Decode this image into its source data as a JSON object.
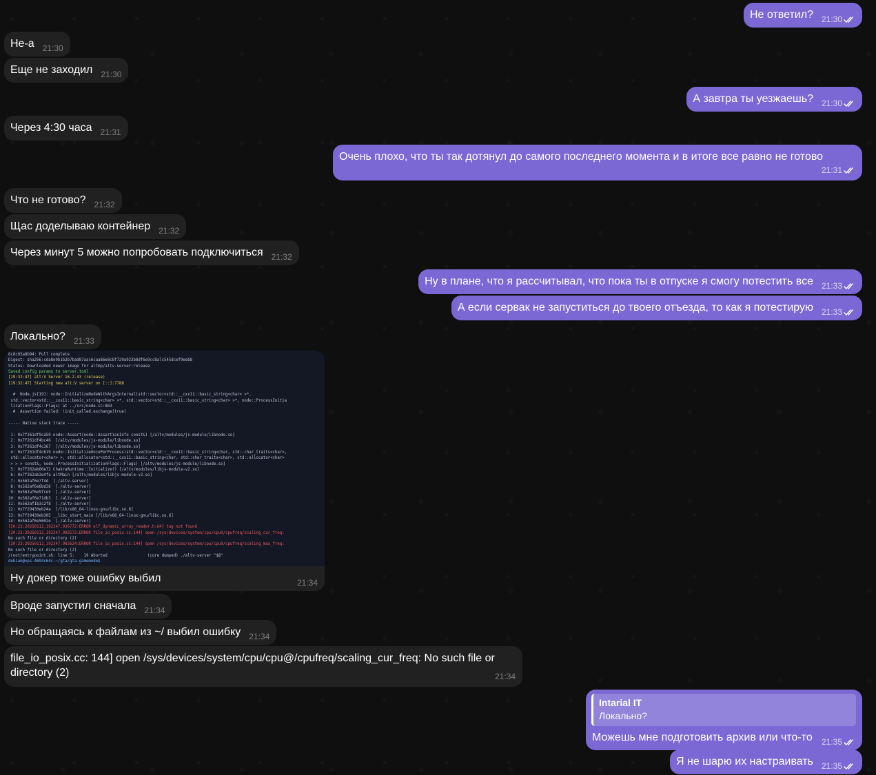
{
  "messages": [
    {
      "dir": "out",
      "text": "Не ответил?",
      "time": "21:30"
    },
    {
      "dir": "in",
      "text": "Не-а",
      "time": "21:30"
    },
    {
      "dir": "in",
      "text": "Еще не заходил",
      "time": "21:30"
    },
    {
      "dir": "out",
      "text": "А завтра ты уезжаешь?",
      "time": "21:30"
    },
    {
      "dir": "in",
      "text": "Через 4:30 часа",
      "time": "21:31"
    },
    {
      "dir": "out",
      "text": "Очень плохо, что ты так дотянул до самого последнего момента и в итоге все равно не готово",
      "time": "21:31"
    },
    {
      "dir": "in",
      "text": "Что не готово?",
      "time": "21:32"
    },
    {
      "dir": "in",
      "text": "Щас доделываю контейнер",
      "time": "21:32"
    },
    {
      "dir": "in",
      "text": "Через минут 5 можно попробовать подключиться",
      "time": "21:32"
    },
    {
      "dir": "out",
      "text": "Ну в плане, что я рассчитывал, что пока ты в отпуске я смогу потестить все",
      "time": "21:33"
    },
    {
      "dir": "out",
      "text": "А если сервак не запуститься до твоего отъезда, то как я потестирую",
      "time": "21:33"
    },
    {
      "dir": "in",
      "text": "Локально?",
      "time": "21:33"
    },
    {
      "dir": "in",
      "text": "Ну докер тоже ошибку выбил",
      "time": "21:34"
    },
    {
      "dir": "in",
      "text": "Вроде запустил сначала",
      "time": "21:34"
    },
    {
      "dir": "in",
      "text": "Но обращаясь к файлам из ~/ выбил ошибку",
      "time": "21:34"
    },
    {
      "dir": "in",
      "text": "file_io_posix.cc: 144] open /sys/devices/system/cpu/cpu@/cpufreq/scaling_cur_freq: No such file or directory (2)",
      "time": "21:34"
    },
    {
      "dir": "out",
      "text": "Можешь мне подготовить архив или что-то",
      "time": "21:35",
      "reply": {
        "author": "Intarial IT",
        "text": "Локально?"
      }
    },
    {
      "dir": "out",
      "text": "Я не шарю их настраивать",
      "time": "21:35"
    }
  ],
  "terminal_lines": [
    "8c8c93a8b94: Pull complete",
    "Digest: sha256:cda8e9b1b2b7bad87aac6caa86e8c8f729a923b8df6e9cc8a7c545dcef9eeb8",
    "Status: Downloaded newer image for altmp/altv-server:release",
    "Saved config params to server.toml",
    "[19:32:47] alt:V Server 16.2.43 (release)",
    "[19:32:47] Starting new alt:V server on [::]:7788",
    "",
    "  #  Node.js[19]: node::InitializeNodeWithArgsInternal(std::vector<std::__cxx11::basic_string<char> >*,",
    " std::vector<std::__cxx11::basic_string<char> >*, std::vector<std::__cxx11::basic_string<char> >*, node::ProcessInitia",
    " lizationFlags::Flags) at ../src/node.cc:863",
    "  #  Assertion failed: !init_called.exchange(true)",
    "",
    "----- Native stack trace -----",
    "",
    " 1: 0x7f261df9ca59 node::Assert(node::AssertionInfo const&) [/altv/modules/js-module/libnode.so]",
    " 2: 0x7f261df4bc46  [/altv/modules/js-module/libnode.so]",
    " 3: 0x7f261df4c367  [/altv/modules/js-module/libnode.so]",
    " 4: 0x7f261df4c619 node::InitializeOncePerProcess(std::vector<std::__cxx11::basic_string<char, std::char_traits<char>,",
    " std::allocator<char> >, std::allocator<std::__cxx11::basic_string<char, std::char_traits<char>, std::allocator<char>",
    " > > > const&, node::ProcessInitializationFlags::Flags) [/altv/modules/js-module/libnode.so]",
    " 5: 0x7f262ab00e72 ChakraRuntime::Initialize() [/altv/modules/libjs-module-v2.so]",
    " 6: 0x7f262ab3e4fa altMain [/altv/modules/libjs-module-v2.so]",
    " 7: 0x562af6e7f4d  [./altv-server]",
    " 8: 0x562af6e6bd36  [./altv-server]",
    " 9: 0x562af6e9fce5  [./altv-server]",
    "10: 0x562af6e71db3  [./altv-server]",
    "11: 0x562af1b3c2f8  [./altv-server]",
    "12: 0x7f29430eb24a  [/lib/x86_64-linux-gnu/libc.so.6]",
    "13: 0x7f29430eb305 __libc_start_main [/lib/x86_64-linux-gnu/libc.so.6]",
    "14: 0x562af6e5602e  [./altv-server]",
    "[20:23:20250112,192247.936772:ERROR elf_dynamic_array_reader.h:64] tag not found",
    "[20:23:20250112,192347.902572:ERROR file_io_posix.cc:144] open /sys/devices/system/cpu/cpu0/cpufreq/scaling_cur_freq:",
    "No such file or directory (2)",
    "[20:23:20250112,192347.902624:ERROR file_io_posix.cc:144] open /sys/devices/system/cpu/cpu0/cpufreq/scaling_max_freq:",
    "No such file or directory (2)",
    "/root/entrypoint.sh: line 5:    19 Aborted                 (core dumped) ./altv-server \"$@\"",
    "debian@vps-4694c64c:~/gta/gta-gamemode$ "
  ],
  "icons": {
    "read_checks": "double-check-icon"
  },
  "colors": {
    "incoming_bubble": "#212121",
    "outgoing_bubble": "#7b68d4",
    "background": "#0f0f0f"
  }
}
